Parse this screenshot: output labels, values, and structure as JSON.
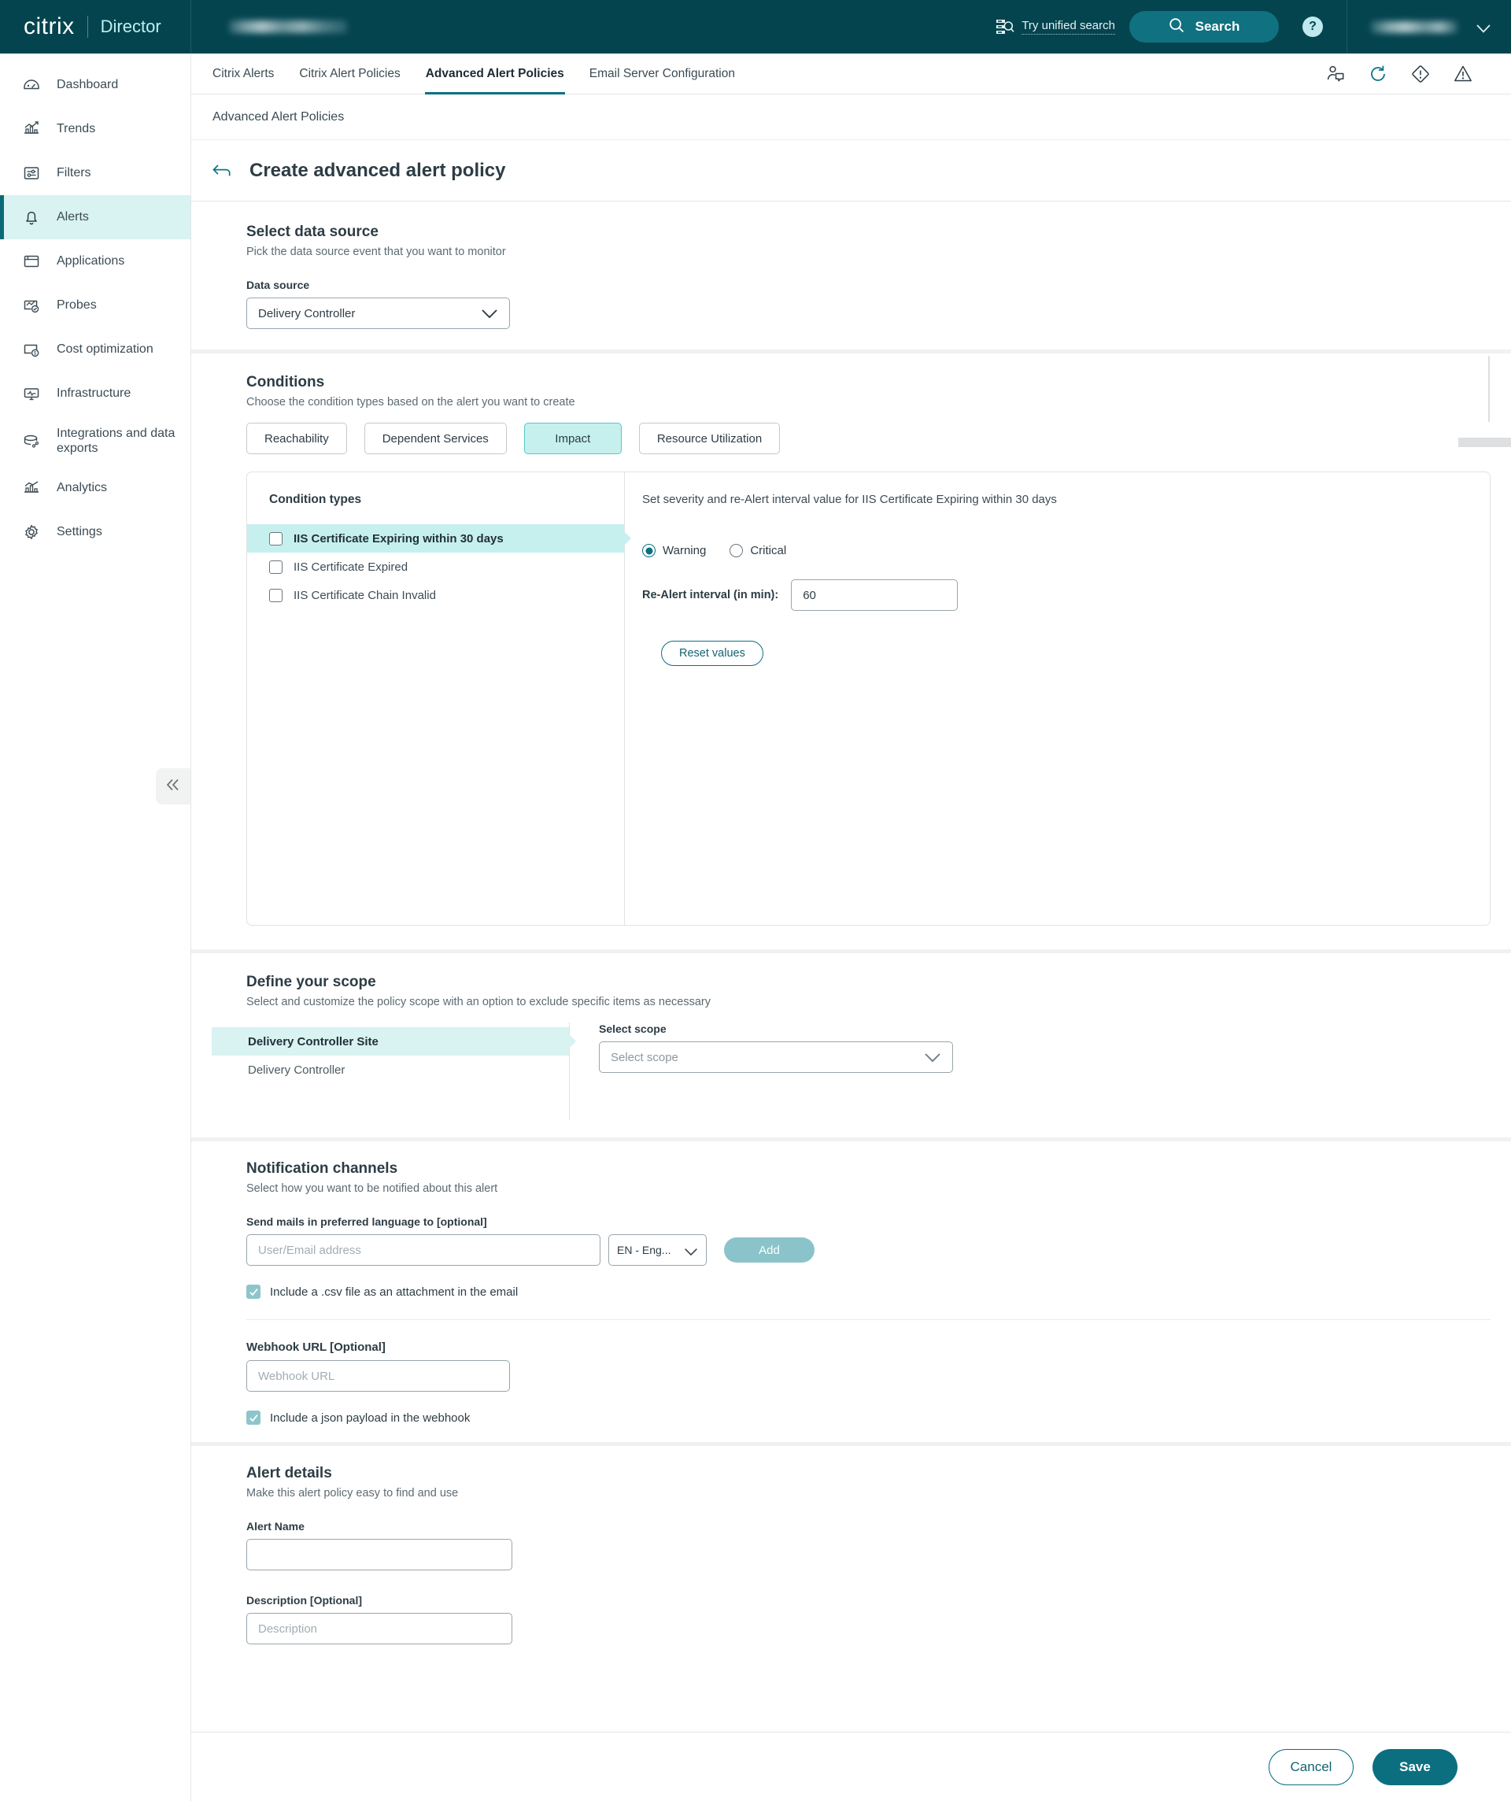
{
  "topbar": {
    "logo": "citrix",
    "product": "Director",
    "tenant_redacted": true,
    "unified_search_label": "Try unified search",
    "unified_search_icon": "list-search-icon",
    "search_label": "Search",
    "search_icon": "search-icon",
    "help_label": "?",
    "help_icon": "help-circle-icon",
    "user_redacted": true,
    "user_chevron_icon": "chevron-down-icon"
  },
  "sidebar": {
    "collapse_icon": "double-chevron-left-icon",
    "items": [
      {
        "label": "Dashboard",
        "icon": "gauge-icon",
        "active": false
      },
      {
        "label": "Trends",
        "icon": "trend-chart-icon",
        "active": false
      },
      {
        "label": "Filters",
        "icon": "filter-sliders-icon",
        "active": false
      },
      {
        "label": "Alerts",
        "icon": "bell-icon",
        "active": true
      },
      {
        "label": "Applications",
        "icon": "window-icon",
        "active": false
      },
      {
        "label": "Probes",
        "icon": "probe-check-icon",
        "active": false
      },
      {
        "label": "Cost optimization",
        "icon": "cost-dollar-icon",
        "active": false
      },
      {
        "label": "Infrastructure",
        "icon": "monitor-pulse-icon",
        "active": false
      },
      {
        "label": "Integrations and data exports",
        "icon": "database-link-icon",
        "active": false
      },
      {
        "label": "Analytics",
        "icon": "analytics-bar-icon",
        "active": false
      },
      {
        "label": "Settings",
        "icon": "gear-icon",
        "active": false
      }
    ]
  },
  "tabs": {
    "items": [
      {
        "label": "Citrix Alerts",
        "active": false
      },
      {
        "label": "Citrix Alert Policies",
        "active": false
      },
      {
        "label": "Advanced Alert Policies",
        "active": true
      },
      {
        "label": "Email Server Configuration",
        "active": false
      }
    ],
    "icons": [
      {
        "name": "user-feedback-icon"
      },
      {
        "name": "refresh-icon"
      },
      {
        "name": "alert-diamond-icon"
      },
      {
        "name": "warning-triangle-icon"
      }
    ]
  },
  "page": {
    "breadcrumb": "Advanced Alert Policies",
    "back_icon": "back-arrow-icon",
    "title": "Create advanced alert policy"
  },
  "data_source": {
    "title": "Select data source",
    "subtitle": "Pick the data source event that you want to monitor",
    "field_label": "Data source",
    "value": "Delivery Controller",
    "chevron_icon": "chevron-down-icon"
  },
  "conditions": {
    "title": "Conditions",
    "subtitle": "Choose the condition types based on the alert you want to create",
    "chips": [
      {
        "label": "Reachability",
        "active": false
      },
      {
        "label": "Dependent Services",
        "active": false
      },
      {
        "label": "Impact",
        "active": true
      },
      {
        "label": "Resource Utilization",
        "active": false
      }
    ],
    "left_title": "Condition types",
    "types": [
      {
        "label": "IIS Certificate Expiring within 30 days",
        "checked": false,
        "active": true
      },
      {
        "label": "IIS Certificate Expired",
        "checked": false,
        "active": false
      },
      {
        "label": "IIS Certificate Chain Invalid",
        "checked": false,
        "active": false
      }
    ],
    "detail_heading": "Set severity and re-Alert interval value for IIS Certificate Expiring within 30 days",
    "severity": {
      "options": [
        {
          "label": "Warning",
          "selected": true
        },
        {
          "label": "Critical",
          "selected": false
        }
      ]
    },
    "interval_label": "Re-Alert interval (in min):",
    "interval_value": "60",
    "reset_label": "Reset values"
  },
  "scope": {
    "title": "Define your scope",
    "subtitle": "Select and customize the policy scope with an option to exclude specific items as necessary",
    "items": [
      {
        "label": "Delivery Controller Site",
        "active": true
      },
      {
        "label": "Delivery Controller",
        "active": false
      }
    ],
    "select_label": "Select scope",
    "select_placeholder": "Select scope",
    "chevron_icon": "chevron-down-icon"
  },
  "notifications": {
    "title": "Notification channels",
    "subtitle": "Select how you want to be notified about this alert",
    "mail_label": "Send mails in preferred language to [optional]",
    "email_placeholder": "User/Email address",
    "email_value": "",
    "language_value": "EN - Eng...",
    "language_chevron_icon": "chevron-down-icon",
    "add_label": "Add",
    "csv_checkbox": {
      "label": "Include a .csv file as an attachment in the email",
      "checked": true
    }
  },
  "webhook": {
    "label": "Webhook URL [Optional]",
    "placeholder": "Webhook URL",
    "value": "",
    "json_checkbox": {
      "label": "Include a json payload in the webhook",
      "checked": true
    }
  },
  "alert_details": {
    "title": "Alert details",
    "subtitle": "Make this alert policy easy to find and use",
    "name_label": "Alert Name",
    "name_value": "",
    "name_placeholder": "",
    "description_label": "Description [Optional]",
    "description_placeholder": "Description",
    "description_value": ""
  },
  "footer": {
    "cancel_label": "Cancel",
    "save_label": "Save"
  },
  "colors": {
    "brand_dark": "#04444f",
    "accent_teal": "#0b6f80",
    "active_cyan": "#c6f0ee",
    "active_nav": "#d9f2f2",
    "muted_teal": "#8bc3ca"
  }
}
